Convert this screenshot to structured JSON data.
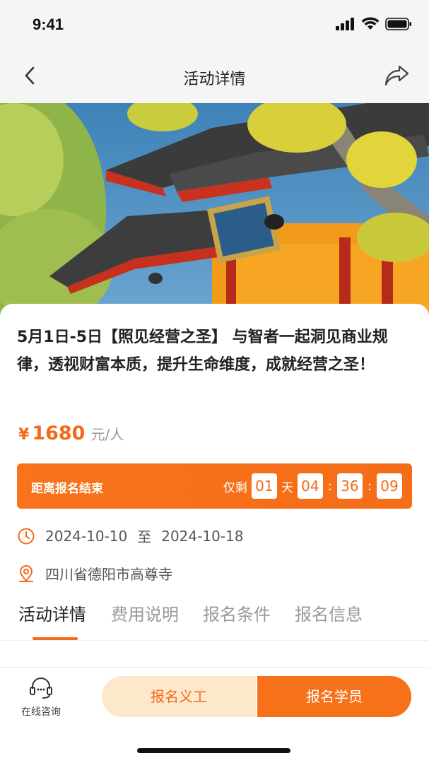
{
  "status_bar": {
    "time": "9:41"
  },
  "nav": {
    "title": "活动详情"
  },
  "event": {
    "title": "5月1日-5日【照见经营之圣】 与智者一起洞见商业规律，透视财富本质，提升生命维度，成就经营之圣！",
    "price_symbol": "¥",
    "price": "1680",
    "price_unit": "元/人"
  },
  "countdown": {
    "label": "距离报名结束",
    "remaining_label": "仅剩",
    "days": "01",
    "day_unit": "天",
    "hours": "04",
    "minutes": "36",
    "seconds": "09"
  },
  "info": {
    "start_date": "2024-10-10",
    "to": "至",
    "end_date": "2024-10-18",
    "location": "四川省德阳市高尊寺"
  },
  "tabs": [
    {
      "label": "活动详情",
      "active": true
    },
    {
      "label": "费用说明",
      "active": false
    },
    {
      "label": "报名条件",
      "active": false
    },
    {
      "label": "报名信息",
      "active": false
    }
  ],
  "bottom": {
    "consult_label": "在线咨询",
    "volunteer_button": "报名义工",
    "student_button": "报名学员"
  },
  "colors": {
    "accent": "#f26a1b",
    "volunteer_bg": "#fde8cc"
  }
}
